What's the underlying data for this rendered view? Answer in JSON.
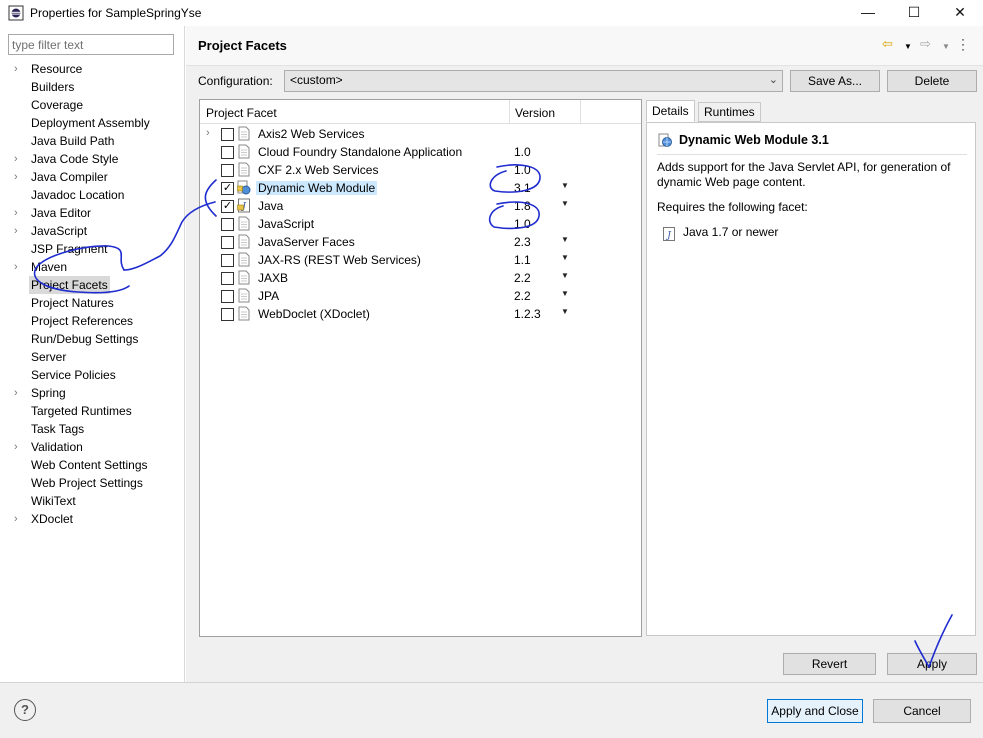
{
  "window": {
    "title": "Properties for SampleSpringYse",
    "minimize_glyph": "—",
    "maximize_glyph": "☐",
    "close_glyph": "✕"
  },
  "filter": {
    "placeholder": "type filter text",
    "value": ""
  },
  "nav": [
    {
      "label": "Resource",
      "expandable": true
    },
    {
      "label": "Builders",
      "expandable": false
    },
    {
      "label": "Coverage",
      "expandable": false
    },
    {
      "label": "Deployment Assembly",
      "expandable": false
    },
    {
      "label": "Java Build Path",
      "expandable": false
    },
    {
      "label": "Java Code Style",
      "expandable": true
    },
    {
      "label": "Java Compiler",
      "expandable": true
    },
    {
      "label": "Javadoc Location",
      "expandable": false
    },
    {
      "label": "Java Editor",
      "expandable": true
    },
    {
      "label": "JavaScript",
      "expandable": true
    },
    {
      "label": "JSP Fragment",
      "expandable": false
    },
    {
      "label": "Maven",
      "expandable": true
    },
    {
      "label": "Project Facets",
      "expandable": false,
      "selected": true
    },
    {
      "label": "Project Natures",
      "expandable": false
    },
    {
      "label": "Project References",
      "expandable": false
    },
    {
      "label": "Run/Debug Settings",
      "expandable": false
    },
    {
      "label": "Server",
      "expandable": false
    },
    {
      "label": "Service Policies",
      "expandable": false
    },
    {
      "label": "Spring",
      "expandable": true
    },
    {
      "label": "Targeted Runtimes",
      "expandable": false
    },
    {
      "label": "Task Tags",
      "expandable": false
    },
    {
      "label": "Validation",
      "expandable": true
    },
    {
      "label": "Web Content Settings",
      "expandable": false
    },
    {
      "label": "Web Project Settings",
      "expandable": false
    },
    {
      "label": "WikiText",
      "expandable": false
    },
    {
      "label": "XDoclet",
      "expandable": true
    }
  ],
  "page": {
    "title": "Project Facets",
    "config_label": "Configuration:",
    "config_value": "<custom>",
    "save_as_label": "Save As...",
    "delete_label": "Delete",
    "revert_label": "Revert",
    "apply_label": "Apply"
  },
  "facets": {
    "col_facet": "Project Facet",
    "col_version": "Version",
    "rows": [
      {
        "name": "Axis2 Web Services",
        "version": "",
        "checked": false,
        "expandable": true,
        "dropdown": false,
        "icon": "doc-icon"
      },
      {
        "name": "Cloud Foundry Standalone Application",
        "version": "1.0",
        "checked": false,
        "expandable": false,
        "dropdown": false,
        "icon": "doc-icon"
      },
      {
        "name": "CXF 2.x Web Services",
        "version": "1.0",
        "checked": false,
        "expandable": false,
        "dropdown": false,
        "icon": "doc-icon"
      },
      {
        "name": "Dynamic Web Module",
        "version": "3.1",
        "checked": true,
        "expandable": false,
        "dropdown": true,
        "icon": "web-module-icon",
        "selected": true
      },
      {
        "name": "Java",
        "version": "1.8",
        "checked": true,
        "expandable": false,
        "dropdown": true,
        "icon": "java-locked-icon"
      },
      {
        "name": "JavaScript",
        "version": "1.0",
        "checked": false,
        "expandable": false,
        "dropdown": false,
        "icon": "doc-icon"
      },
      {
        "name": "JavaServer Faces",
        "version": "2.3",
        "checked": false,
        "expandable": false,
        "dropdown": true,
        "icon": "doc-icon"
      },
      {
        "name": "JAX-RS (REST Web Services)",
        "version": "1.1",
        "checked": false,
        "expandable": false,
        "dropdown": true,
        "icon": "doc-icon"
      },
      {
        "name": "JAXB",
        "version": "2.2",
        "checked": false,
        "expandable": false,
        "dropdown": true,
        "icon": "doc-icon"
      },
      {
        "name": "JPA",
        "version": "2.2",
        "checked": false,
        "expandable": false,
        "dropdown": true,
        "icon": "doc-icon"
      },
      {
        "name": "WebDoclet (XDoclet)",
        "version": "1.2.3",
        "checked": false,
        "expandable": false,
        "dropdown": true,
        "icon": "doc-icon"
      }
    ]
  },
  "details": {
    "tab_details": "Details",
    "tab_runtimes": "Runtimes",
    "title": "Dynamic Web Module 3.1",
    "description": "Adds support for the Java Servlet API, for generation of dynamic Web page content.",
    "requires_label": "Requires the following facet:",
    "requirement": "Java 1.7 or newer"
  },
  "footer": {
    "help_glyph": "?",
    "apply_close_label": "Apply and Close",
    "cancel_label": "Cancel"
  },
  "colors": {
    "selection_blue": "#cce8ff",
    "default_button_border": "#0078d7",
    "annotation_ink": "#1f2ccf"
  }
}
